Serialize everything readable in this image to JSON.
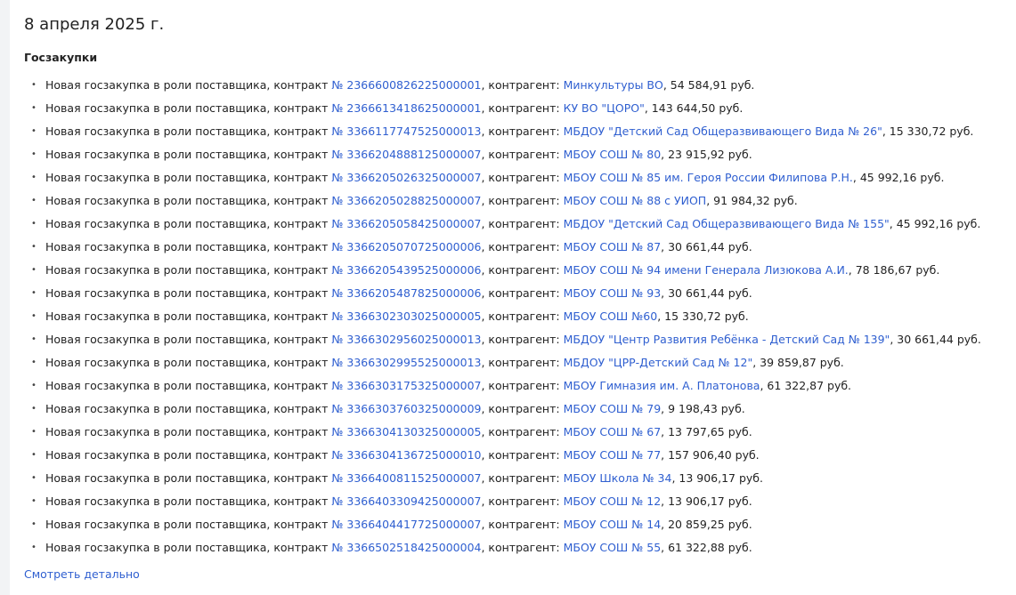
{
  "page": {
    "date": "8 апреля 2025 г.",
    "section_title": "Госзакупки",
    "more_link": "Смотреть детально"
  },
  "colors": {
    "link": "#2f5fd0",
    "text": "#222222",
    "background": "#f2f3f5",
    "card": "#ffffff"
  },
  "items": [
    {
      "prefix": "Новая госзакупка в роли поставщика, контракт ",
      "contract": "№ 2366600826225000001",
      "mid": ", контрагент: ",
      "counterparty": "Минкультуры ВО",
      "amount": ", 54 584,91 руб."
    },
    {
      "prefix": "Новая госзакупка в роли поставщика, контракт ",
      "contract": "№ 2366613418625000001",
      "mid": ", контрагент: ",
      "counterparty": "КУ ВО \"ЦОРО\"",
      "amount": ", 143 644,50 руб."
    },
    {
      "prefix": "Новая госзакупка в роли поставщика, контракт ",
      "contract": "№ 3366117747525000013",
      "mid": ", контрагент: ",
      "counterparty": "МБДОУ \"Детский Сад Общеразвивающего Вида № 26\"",
      "amount": ", 15 330,72 руб."
    },
    {
      "prefix": "Новая госзакупка в роли поставщика, контракт ",
      "contract": "№ 3366204888125000007",
      "mid": ", контрагент: ",
      "counterparty": "МБОУ СОШ № 80",
      "amount": ", 23 915,92 руб."
    },
    {
      "prefix": "Новая госзакупка в роли поставщика, контракт ",
      "contract": "№ 3366205026325000007",
      "mid": ", контрагент: ",
      "counterparty": "МБОУ СОШ № 85 им. Героя России Филипова Р.Н.",
      "amount": ", 45 992,16 руб."
    },
    {
      "prefix": "Новая госзакупка в роли поставщика, контракт ",
      "contract": "№ 3366205028825000007",
      "mid": ", контрагент: ",
      "counterparty": "МБОУ СОШ № 88 с УИОП",
      "amount": ", 91 984,32 руб."
    },
    {
      "prefix": "Новая госзакупка в роли поставщика, контракт ",
      "contract": "№ 3366205058425000007",
      "mid": ", контрагент: ",
      "counterparty": "МБДОУ \"Детский Сад Общеразвивающего Вида № 155\"",
      "amount": ", 45 992,16 руб."
    },
    {
      "prefix": "Новая госзакупка в роли поставщика, контракт ",
      "contract": "№ 3366205070725000006",
      "mid": ", контрагент: ",
      "counterparty": "МБОУ СОШ № 87",
      "amount": ", 30 661,44 руб."
    },
    {
      "prefix": "Новая госзакупка в роли поставщика, контракт ",
      "contract": "№ 3366205439525000006",
      "mid": ", контрагент: ",
      "counterparty": "МБОУ СОШ № 94 имени Генерала Лизюкова А.И.",
      "amount": ", 78 186,67 руб."
    },
    {
      "prefix": "Новая госзакупка в роли поставщика, контракт ",
      "contract": "№ 3366205487825000006",
      "mid": ", контрагент: ",
      "counterparty": "МБОУ СОШ № 93",
      "amount": ", 30 661,44 руб."
    },
    {
      "prefix": "Новая госзакупка в роли поставщика, контракт ",
      "contract": "№ 3366302303025000005",
      "mid": ", контрагент: ",
      "counterparty": "МБОУ СОШ №60",
      "amount": ", 15 330,72 руб."
    },
    {
      "prefix": "Новая госзакупка в роли поставщика, контракт ",
      "contract": "№ 3366302956025000013",
      "mid": ", контрагент: ",
      "counterparty": "МБДОУ \"Центр Развития Ребёнка - Детский Сад № 139\"",
      "amount": ", 30 661,44 руб."
    },
    {
      "prefix": "Новая госзакупка в роли поставщика, контракт ",
      "contract": "№ 3366302995525000013",
      "mid": ", контрагент: ",
      "counterparty": "МБДОУ \"ЦРР-Детский Сад № 12\"",
      "amount": ", 39 859,87 руб."
    },
    {
      "prefix": "Новая госзакупка в роли поставщика, контракт ",
      "contract": "№ 3366303175325000007",
      "mid": ", контрагент: ",
      "counterparty": "МБОУ Гимназия им. А. Платонова",
      "amount": ", 61 322,87 руб."
    },
    {
      "prefix": "Новая госзакупка в роли поставщика, контракт ",
      "contract": "№ 3366303760325000009",
      "mid": ", контрагент: ",
      "counterparty": "МБОУ СОШ № 79",
      "amount": ", 9 198,43 руб."
    },
    {
      "prefix": "Новая госзакупка в роли поставщика, контракт ",
      "contract": "№ 3366304130325000005",
      "mid": ", контрагент: ",
      "counterparty": "МБОУ СОШ № 67",
      "amount": ", 13 797,65 руб."
    },
    {
      "prefix": "Новая госзакупка в роли поставщика, контракт ",
      "contract": "№ 3366304136725000010",
      "mid": ", контрагент: ",
      "counterparty": "МБОУ СОШ № 77",
      "amount": ", 157 906,40 руб."
    },
    {
      "prefix": "Новая госзакупка в роли поставщика, контракт ",
      "contract": "№ 3366400811525000007",
      "mid": ", контрагент: ",
      "counterparty": "МБОУ Школа № 34",
      "amount": ", 13 906,17 руб."
    },
    {
      "prefix": "Новая госзакупка в роли поставщика, контракт ",
      "contract": "№ 3366403309425000007",
      "mid": ", контрагент: ",
      "counterparty": "МБОУ СОШ № 12",
      "amount": ", 13 906,17 руб."
    },
    {
      "prefix": "Новая госзакупка в роли поставщика, контракт ",
      "contract": "№ 3366404417725000007",
      "mid": ", контрагент: ",
      "counterparty": "МБОУ СОШ № 14",
      "amount": ", 20 859,25 руб."
    },
    {
      "prefix": "Новая госзакупка в роли поставщика, контракт ",
      "contract": "№ 3366502518425000004",
      "mid": ", контрагент: ",
      "counterparty": "МБОУ СОШ № 55",
      "amount": ", 61 322,88 руб."
    }
  ]
}
